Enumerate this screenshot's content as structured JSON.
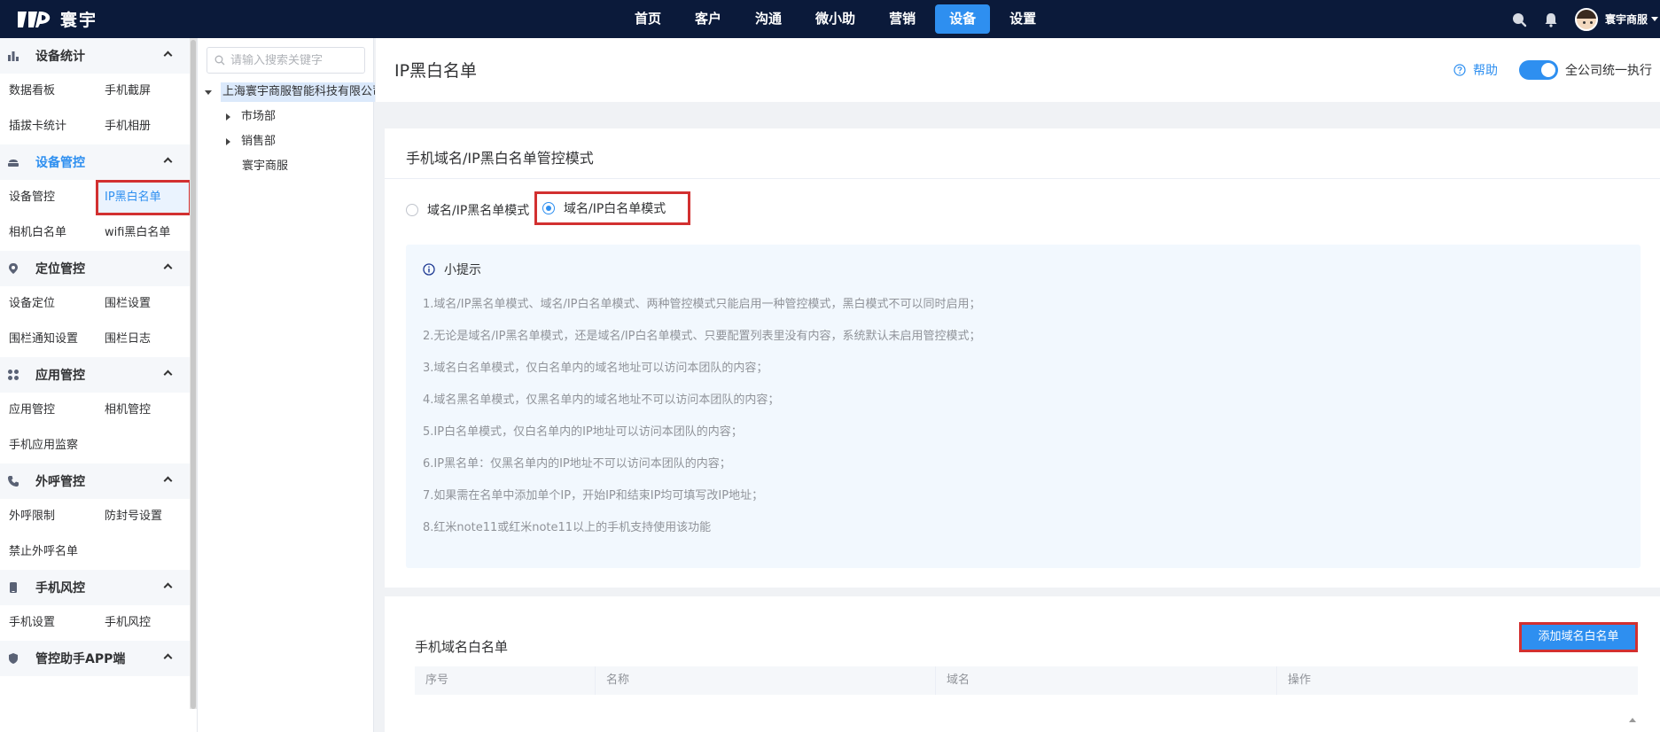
{
  "brand": {
    "name": "寰宇"
  },
  "nav": {
    "items": [
      "首页",
      "客户",
      "沟通",
      "微小助",
      "营销",
      "设备",
      "设置"
    ],
    "active": "设备"
  },
  "user": {
    "name": "寰宇商服"
  },
  "colors": {
    "topbar": "#0b1a3a",
    "accent": "#2e8ff0",
    "highlight": "#d23030"
  },
  "sidebar": {
    "sections": [
      {
        "title": "设备统计",
        "icon": "bar-chart-icon",
        "items": [
          [
            "数据看板",
            "手机截屏"
          ],
          [
            "插拔卡统计",
            "手机相册"
          ]
        ]
      },
      {
        "title": "设备管控",
        "icon": "device-icon",
        "active": true,
        "items": [
          [
            "设备管控",
            "IP黑白名单"
          ],
          [
            "相机白名单",
            "wifi黑白名单"
          ]
        ]
      },
      {
        "title": "定位管控",
        "icon": "location-icon",
        "items": [
          [
            "设备定位",
            "围栏设置"
          ],
          [
            "围栏通知设置",
            "围栏日志"
          ]
        ]
      },
      {
        "title": "应用管控",
        "icon": "apps-icon",
        "items": [
          [
            "应用管控",
            "相机管控"
          ],
          [
            "手机应用监察"
          ]
        ]
      },
      {
        "title": "外呼管控",
        "icon": "phone-icon",
        "items": [
          [
            "外呼限制",
            "防封号设置"
          ],
          [
            "禁止外呼名单"
          ]
        ]
      },
      {
        "title": "手机风控",
        "icon": "mobile-icon",
        "items": [
          [
            "手机设置",
            "手机风控"
          ]
        ]
      },
      {
        "title": "管控助手APP端",
        "icon": "shield-icon",
        "items": []
      }
    ]
  },
  "tree": {
    "search_placeholder": "请输入搜索关键字",
    "root": "上海寰宇商服智能科技有限公司",
    "children": [
      "市场部",
      "销售部",
      "寰宇商服"
    ]
  },
  "page": {
    "title": "IP黑白名单",
    "help": "帮助",
    "toggle_label": "全公司统一执行",
    "toggle_on": true
  },
  "mode_card": {
    "title": "手机域名/IP黑白名单管控模式",
    "options": [
      "域名/IP黑名单模式",
      "域名/IP白名单模式"
    ],
    "selected": "域名/IP白名单模式",
    "tips_title": "小提示",
    "tips": [
      "1.域名/IP黑名单模式、域名/IP白名单模式、两种管控模式只能启用一种管控模式，黑白模式不可以同时启用；",
      "2.无论是域名/IP黑名单模式，还是域名/IP白名单模式、只要配置列表里没有内容，系统默认未启用管控模式；",
      "3.域名白名单模式，仅白名单内的域名地址可以访问本团队的内容；",
      "4.域名黑名单模式，仅黑名单内的域名地址不可以访问本团队的内容；",
      "5.IP白名单模式，仅白名单内的IP地址可以访问本团队的内容；",
      "6.IP黑名单：仅黑名单内的IP地址不可以访问本团队的内容；",
      "7.如果需在名单中添加单个IP，开始IP和结束IP均可填写改IP地址；",
      "8.红米note11或红米note11以上的手机支持使用该功能"
    ]
  },
  "list_card": {
    "title": "手机域名白名单",
    "add_button": "添加域名白名单",
    "columns": [
      "序号",
      "名称",
      "域名",
      "操作"
    ]
  }
}
